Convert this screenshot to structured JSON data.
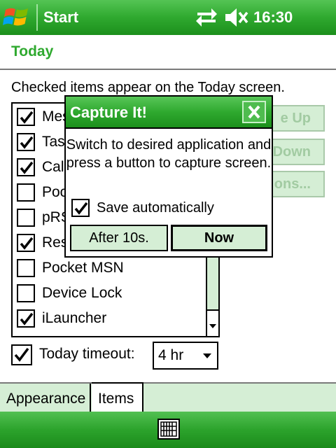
{
  "titlebar": {
    "title": "Start",
    "clock": "16:30",
    "icons": [
      "windows-start-icon",
      "connectivity-icon",
      "speaker-muted-icon"
    ]
  },
  "page": {
    "title": "Today",
    "description": "Checked items appear on the Today screen."
  },
  "items_list": [
    {
      "label": "Mes",
      "checked": true
    },
    {
      "label": "Tas",
      "checked": true
    },
    {
      "label": "Cale",
      "checked": true
    },
    {
      "label": "Poc",
      "checked": false
    },
    {
      "label": "pRS",
      "checked": false
    },
    {
      "label": "Res",
      "checked": true
    },
    {
      "label": "Pocket MSN",
      "checked": false
    },
    {
      "label": "Device Lock",
      "checked": false
    },
    {
      "label": "iLauncher",
      "checked": true
    }
  ],
  "side_buttons": {
    "move_up": "e Up",
    "move_down": "Down",
    "options": "ons..."
  },
  "timeout": {
    "label": "Today timeout:",
    "checked": true,
    "value": "4 hr"
  },
  "tabs": [
    {
      "label": "Appearance",
      "active": false
    },
    {
      "label": "Items",
      "active": true
    }
  ],
  "dialog": {
    "title": "Capture It!",
    "close_label": "✕",
    "message": "Switch to desired application and press a button to capture screen.",
    "save_auto_label": "Save automatically",
    "save_auto_checked": true,
    "after_button": "After 10s.",
    "now_button": "Now"
  },
  "colors": {
    "accent_green": "#2fa92f",
    "light_green": "#d5eed5"
  }
}
